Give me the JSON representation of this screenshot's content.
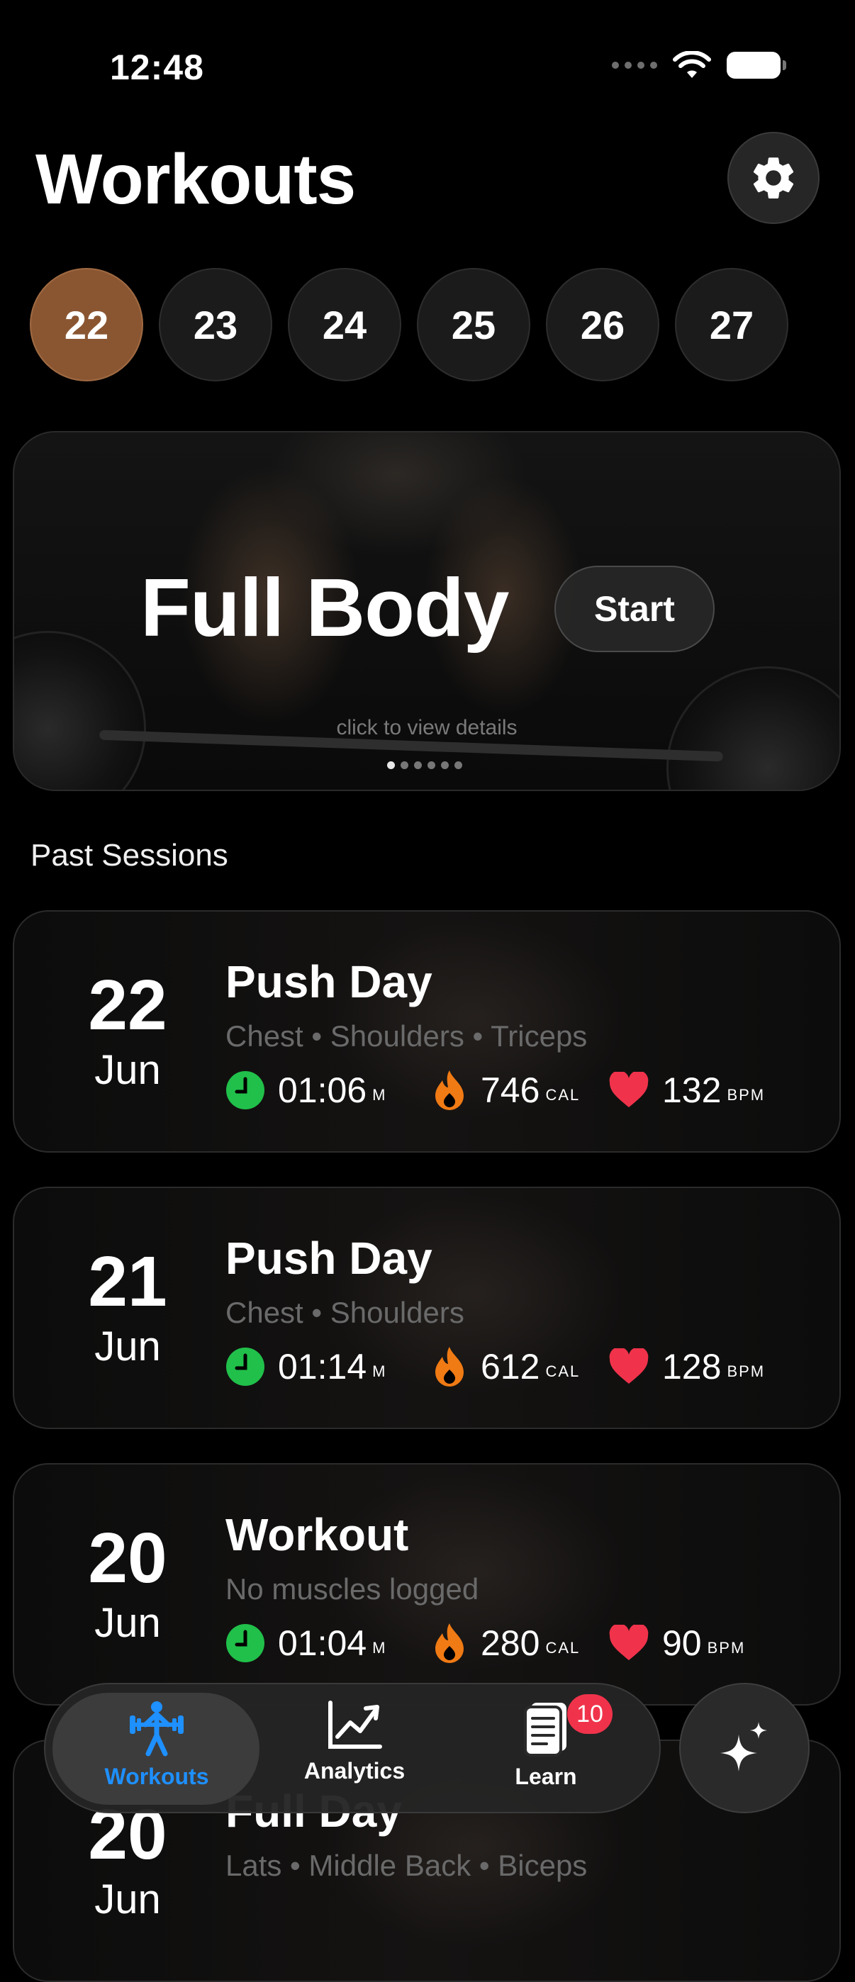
{
  "status_bar": {
    "time": "12:48"
  },
  "header": {
    "title": "Workouts"
  },
  "days": [
    "22",
    "23",
    "24",
    "25",
    "26",
    "27"
  ],
  "selected_day": "22",
  "hero": {
    "title": "Full Body",
    "start_label": "Start",
    "hint": "click to view details",
    "page_count": 6,
    "current_page": 1
  },
  "past_sessions": {
    "label": "Past Sessions",
    "items": [
      {
        "day": "22",
        "month": "Jun",
        "name": "Push Day",
        "muscles": "Chest • Shoulders • Triceps",
        "time": "01:06",
        "time_unit": "M",
        "cal": "746",
        "cal_unit": "CAL",
        "bpm": "132",
        "bpm_unit": "BPM"
      },
      {
        "day": "21",
        "month": "Jun",
        "name": "Push Day",
        "muscles": "Chest • Shoulders",
        "time": "01:14",
        "time_unit": "M",
        "cal": "612",
        "cal_unit": "CAL",
        "bpm": "128",
        "bpm_unit": "BPM"
      },
      {
        "day": "20",
        "month": "Jun",
        "name": "Workout",
        "muscles": "No muscles logged",
        "time": "01:04",
        "time_unit": "M",
        "cal": "280",
        "cal_unit": "CAL",
        "bpm": "90",
        "bpm_unit": "BPM"
      },
      {
        "day": "20",
        "month": "Jun",
        "name": "Full Day",
        "muscles": "Lats • Middle Back • Biceps"
      }
    ]
  },
  "tabbar": {
    "tabs": [
      {
        "label": "Workouts",
        "icon": "weightlifter-icon",
        "active": true
      },
      {
        "label": "Analytics",
        "icon": "chart-line-icon",
        "active": false
      },
      {
        "label": "Learn",
        "icon": "book-icon",
        "active": false,
        "badge": "10"
      }
    ]
  },
  "colors": {
    "accent_day": "#8a5632",
    "active_tab": "#1e90ff",
    "clock_green": "#21c04a",
    "flame_orange": "#f07a14",
    "heart_red": "#f0334b",
    "badge_red": "#f0334b"
  }
}
